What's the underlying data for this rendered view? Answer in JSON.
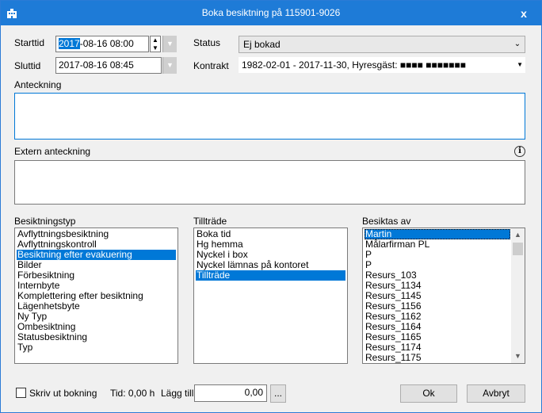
{
  "window": {
    "title": "Boka besiktning på 115901-9026",
    "close": "x"
  },
  "form": {
    "start": {
      "label": "Starttid",
      "value_highlight": "2017",
      "value_rest": "-08-16 08:00"
    },
    "end": {
      "label": "Sluttid",
      "value": "2017-08-16 08:45"
    },
    "status": {
      "label": "Status",
      "value": "Ej bokad"
    },
    "contract": {
      "label": "Kontrakt",
      "value": "1982-02-01 - 2017-11-30, Hyresgäst: ■■■■ ■■■■■■■"
    },
    "note": {
      "label": "Anteckning"
    },
    "external_note": {
      "label": "Extern anteckning"
    }
  },
  "lists": {
    "type": {
      "label": "Besiktningstyp",
      "items": [
        "Avflyttningsbesiktning",
        "Avflyttningskontroll",
        "Besiktning efter evakuering",
        "Bilder",
        "Förbesiktning",
        "Internbyte",
        "Komplettering efter besiktning",
        "Lägenhetsbyte",
        "Ny Typ",
        "Ombesiktning",
        "Statusbesiktning",
        "Typ"
      ],
      "selected": "Besiktning efter evakuering"
    },
    "access": {
      "label": "Tillträde",
      "items": [
        "Boka tid",
        "Hg hemma",
        "Nyckel i box",
        "Nyckel lämnas på kontoret",
        "Tillträde"
      ],
      "selected": "Tillträde"
    },
    "inspector": {
      "label": "Besiktas av",
      "items": [
        "Martin",
        "Målarfirman PL",
        "P",
        "P",
        "Resurs_103",
        "Resurs_1134",
        "Resurs_1145",
        "Resurs_1156",
        "Resurs_1162",
        "Resurs_1164",
        "Resurs_1165",
        "Resurs_1174",
        "Resurs_1175"
      ],
      "selected": "Martin"
    }
  },
  "footer": {
    "print_label": "Skriv ut bokning",
    "time_text": "Tid: 0,00 h",
    "add_label": "Lägg till:",
    "add_value": "0,00",
    "ellipsis": "...",
    "ok": "Ok",
    "cancel": "Avbryt"
  },
  "icons": {
    "app": "building-icon",
    "info": "info-icon",
    "spin_up": "▲",
    "spin_down": "▼",
    "dropdown": "▼",
    "scroll_up": "▲",
    "scroll_down": "▼"
  },
  "colors": {
    "titlebar": "#1e7bd7",
    "selection": "#0078d7",
    "dialog_bg": "#f0f0f0"
  }
}
